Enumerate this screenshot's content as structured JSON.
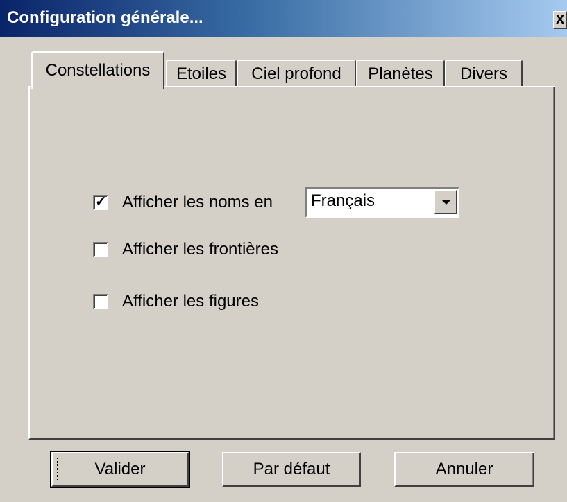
{
  "window": {
    "title": "Configuration générale...",
    "close_label": "X"
  },
  "tabs": [
    {
      "label": "Constellations",
      "active": true
    },
    {
      "label": "Etoiles",
      "active": false
    },
    {
      "label": "Ciel profond",
      "active": false
    },
    {
      "label": "Planètes",
      "active": false
    },
    {
      "label": "Divers",
      "active": false
    }
  ],
  "options": {
    "show_names": {
      "label": "Afficher les noms en",
      "checked": true
    },
    "show_borders": {
      "label": "Afficher les frontières",
      "checked": false
    },
    "show_figures": {
      "label": "Afficher les figures",
      "checked": false
    }
  },
  "language_select": {
    "value": "Français"
  },
  "buttons": {
    "validate": "Valider",
    "default": "Par défaut",
    "cancel": "Annuler"
  }
}
